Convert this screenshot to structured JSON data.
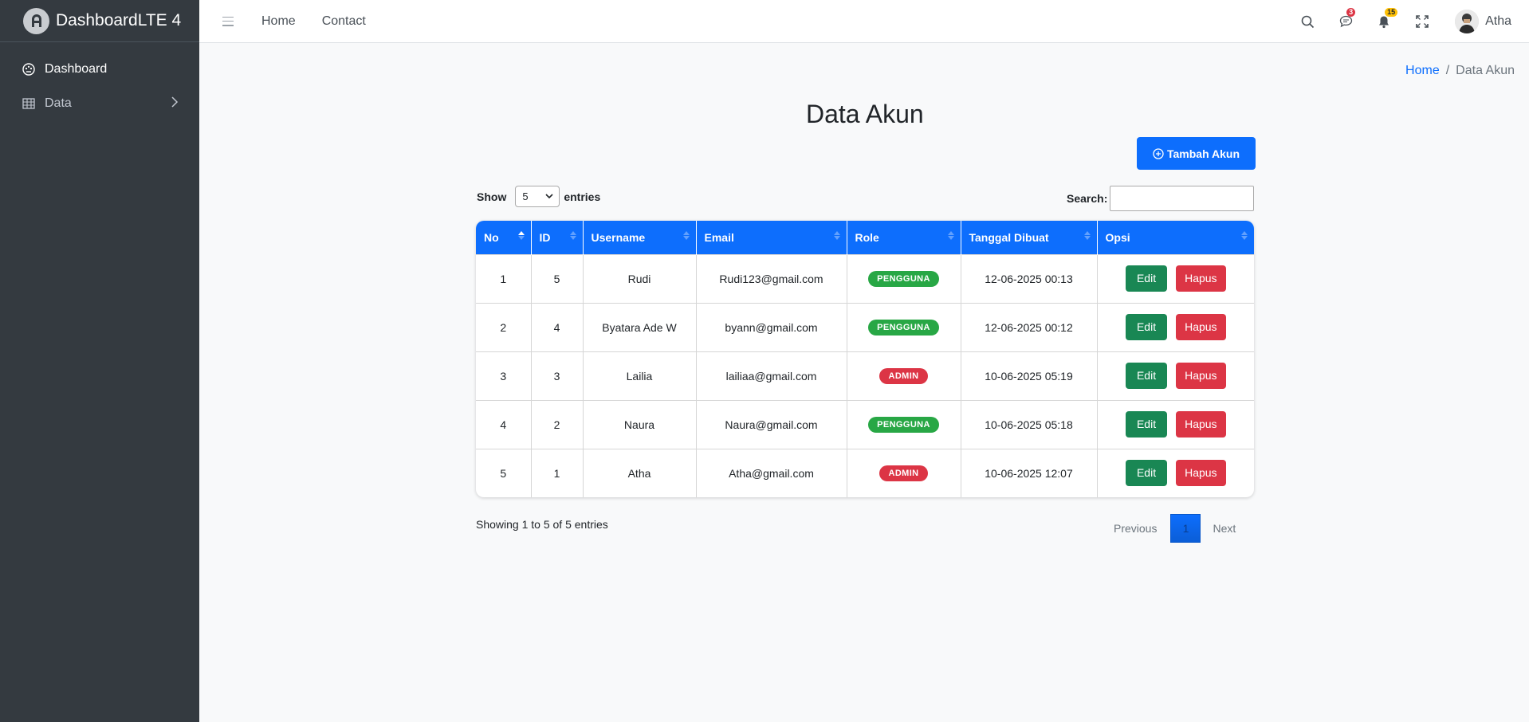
{
  "brand": {
    "name": "DashboardLTE 4"
  },
  "sidebar": {
    "items": [
      {
        "label": "Dashboard",
        "icon": "palette-icon"
      },
      {
        "label": "Data",
        "icon": "table-icon"
      }
    ]
  },
  "topbar": {
    "links": [
      "Home",
      "Contact"
    ],
    "messages_count": "3",
    "notifications_count": "15",
    "user_name": "Atha"
  },
  "breadcrumb": {
    "home": "Home",
    "current": "Data Akun"
  },
  "page": {
    "title": "Data Akun",
    "add_button": "Tambah Akun"
  },
  "table_controls": {
    "show_label": "Show",
    "entries_value": "5",
    "entries_label": "entries",
    "search_label": "Search:",
    "search_value": ""
  },
  "table": {
    "columns": [
      "No",
      "ID",
      "Username",
      "Email",
      "Role",
      "Tanggal Dibuat",
      "Opsi"
    ],
    "rows": [
      {
        "no": "1",
        "id": "5",
        "username": "Rudi",
        "email": "Rudi123@gmail.com",
        "role": "PENGGUNA",
        "created": "12-06-2025 00:13"
      },
      {
        "no": "2",
        "id": "4",
        "username": "Byatara Ade W",
        "email": "byann@gmail.com",
        "role": "PENGGUNA",
        "created": "12-06-2025 00:12"
      },
      {
        "no": "3",
        "id": "3",
        "username": "Lailia",
        "email": "lailiaa@gmail.com",
        "role": "ADMIN",
        "created": "10-06-2025 05:19"
      },
      {
        "no": "4",
        "id": "2",
        "username": "Naura",
        "email": "Naura@gmail.com",
        "role": "PENGGUNA",
        "created": "10-06-2025 05:18"
      },
      {
        "no": "5",
        "id": "1",
        "username": "Atha",
        "email": "Atha@gmail.com",
        "role": "ADMIN",
        "created": "10-06-2025 12:07"
      }
    ],
    "edit_label": "Edit",
    "delete_label": "Hapus"
  },
  "footer": {
    "info": "Showing 1 to 5 of 5 entries",
    "previous": "Previous",
    "current_page": "1",
    "next": "Next"
  },
  "colors": {
    "primary": "#0d6efd",
    "sidebar_bg": "#343a40",
    "success": "#198754",
    "danger": "#dc3545",
    "badge_pengguna": "#28a745"
  }
}
